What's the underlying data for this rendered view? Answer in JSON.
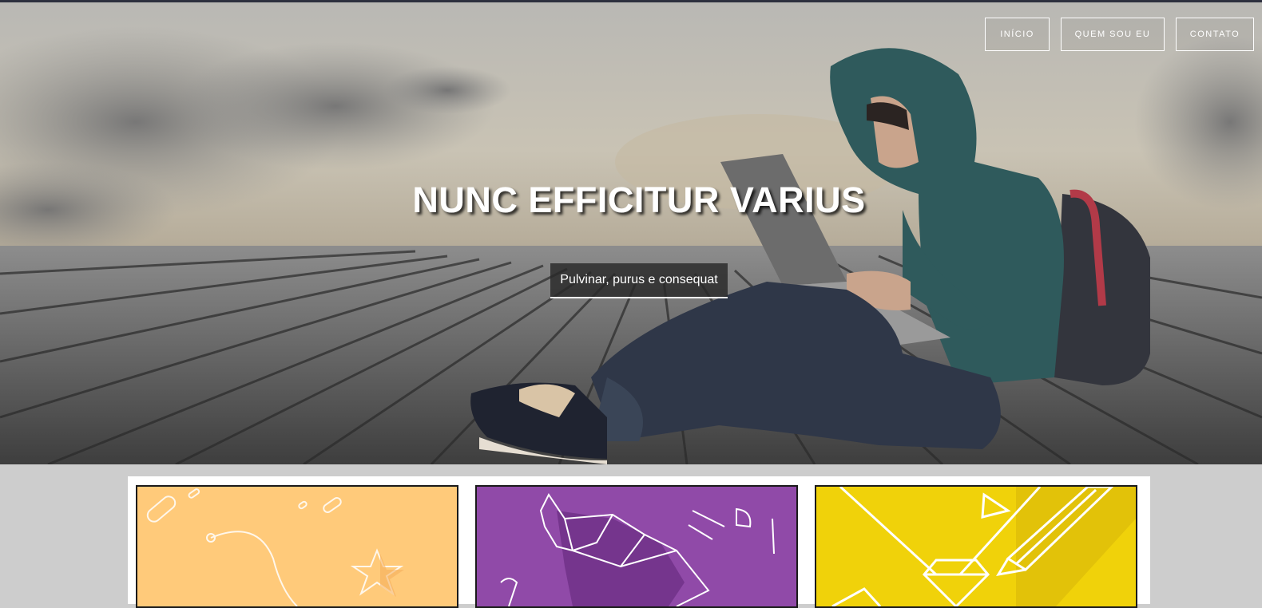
{
  "nav": {
    "items": [
      {
        "label": "INÍCIO"
      },
      {
        "label": "QUEM SOU EU"
      },
      {
        "label": "CONTATO"
      }
    ]
  },
  "hero": {
    "title": "NUNC EFFICITUR VARIUS",
    "cta_label": "Pulvinar, purus e consequat"
  },
  "portfolio": {
    "cards": [
      {
        "color": "#ffca7a"
      },
      {
        "color": "#904aa8"
      },
      {
        "color": "#f0d20a"
      }
    ]
  }
}
